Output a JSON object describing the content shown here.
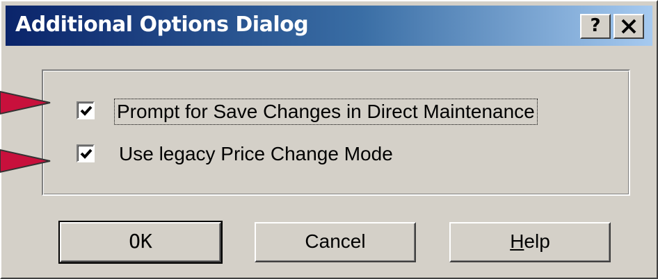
{
  "window": {
    "title": "Additional Options Dialog",
    "help_button": "?",
    "close_button": "✕"
  },
  "options": [
    {
      "label": "Prompt for Save Changes in Direct Maintenance",
      "checked": true,
      "focused": true
    },
    {
      "label": "Use legacy Price Change Mode",
      "checked": true,
      "focused": false
    }
  ],
  "buttons": {
    "ok": "OK",
    "cancel": "Cancel",
    "help_mnemonic": "H",
    "help_rest": "elp"
  },
  "annotations": {
    "arrow_color": "#c8103c",
    "arrow_icon": "pointer-arrow"
  },
  "colors": {
    "titlebar_start": "#0a246a",
    "titlebar_end": "#a6caf0",
    "face": "#d4d0c8"
  }
}
